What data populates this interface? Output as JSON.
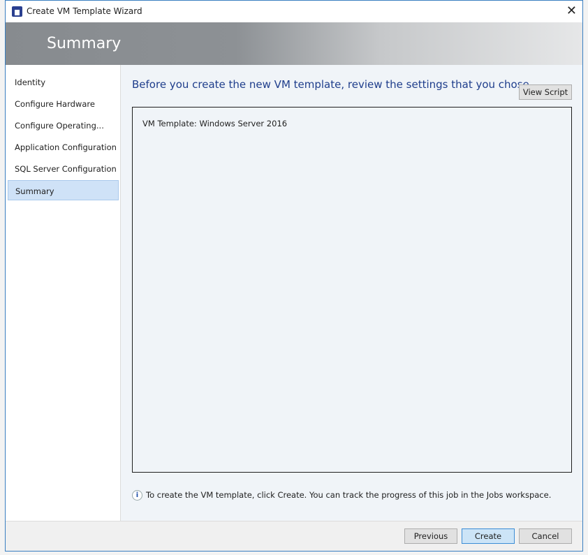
{
  "window": {
    "title": "Create VM Template Wizard"
  },
  "header": {
    "title": "Summary"
  },
  "sidebar": {
    "items": [
      {
        "label": "Identity"
      },
      {
        "label": "Configure Hardware"
      },
      {
        "label": "Configure Operating..."
      },
      {
        "label": "Application Configuration"
      },
      {
        "label": "SQL Server Configuration"
      },
      {
        "label": "Summary",
        "active": true
      }
    ]
  },
  "main": {
    "heading": "Before you create the new VM template, review the settings that you chose",
    "view_script_label": "View Script",
    "summary_text": "VM Template: Windows Server 2016",
    "info_text": "To create the VM template, click Create. You can track the progress of this job in the Jobs workspace."
  },
  "footer": {
    "previous_label": "Previous",
    "create_label": "Create",
    "cancel_label": "Cancel"
  },
  "colors": {
    "accent": "#1f3e8c",
    "active_nav": "#cfe2f7",
    "primary_button": "#cce4f7"
  }
}
